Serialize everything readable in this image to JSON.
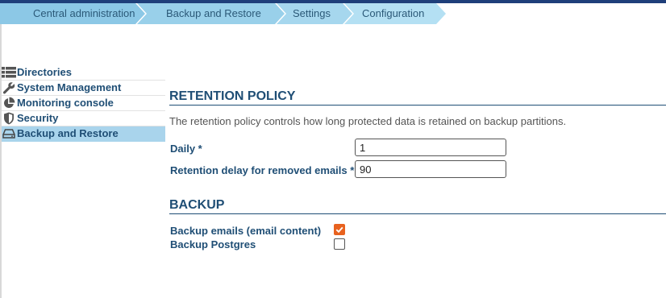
{
  "breadcrumb": [
    "Central administration",
    "Backup and Restore",
    "Settings",
    "Configuration"
  ],
  "sidebar": {
    "items": [
      {
        "label": "Directories",
        "icon": "list-icon"
      },
      {
        "label": "System Management",
        "icon": "wrench-icon"
      },
      {
        "label": "Monitoring console",
        "icon": "pie-chart-icon"
      },
      {
        "label": "Security",
        "icon": "shield-icon"
      },
      {
        "label": "Backup and Restore",
        "icon": "hard-drive-icon",
        "active": true
      }
    ]
  },
  "retention": {
    "title": "RETENTION POLICY",
    "description": "The retention policy controls how long protected data is retained on backup partitions.",
    "daily_label": "Daily *",
    "daily_value": "1",
    "removed_label": "Retention delay for removed emails *",
    "removed_value": "90"
  },
  "backup": {
    "title": "BACKUP",
    "emails_label": "Backup emails (email content)",
    "emails_checked": true,
    "postgres_label": "Backup Postgres",
    "postgres_checked": false
  },
  "colors": {
    "accent": "#e8621f",
    "heading": "#1f4e75",
    "active": "#a9d4ec",
    "topbar": "#1f3f7a"
  }
}
